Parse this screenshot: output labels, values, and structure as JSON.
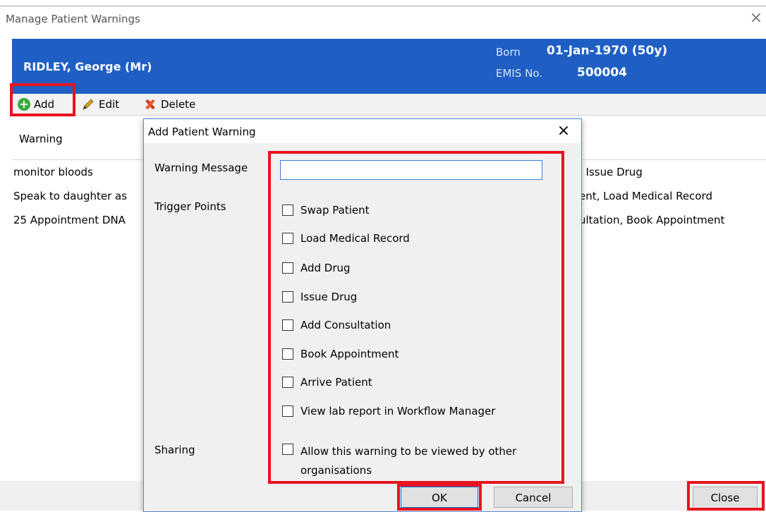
{
  "window": {
    "title": "Manage Patient Warnings",
    "close_glyph": "×"
  },
  "patient": {
    "name": "RIDLEY, George (Mr)",
    "born_label": "Born",
    "born_value": "01-Jan-1970 (50y)",
    "emis_label": "EMIS No.",
    "emis_value": "500004",
    "banner_color": "#1f5fc4"
  },
  "toolbar": {
    "add_label": "Add",
    "edit_label": "Edit",
    "delete_label": "Delete"
  },
  "grid": {
    "column_warning": "Warning",
    "rows": [
      {
        "warning": "monitor bloods",
        "triggers": ". Issue Drug"
      },
      {
        "warning": "Speak to daughter as",
        "triggers": "ent, Load Medical Record"
      },
      {
        "warning": "25 Appointment DNA",
        "triggers": "ultation, Book Appointment"
      }
    ]
  },
  "dialog": {
    "title": "Add Patient Warning",
    "close_glyph": "×",
    "message_label": "Warning Message",
    "message_value": "",
    "trigger_label": "Trigger Points",
    "triggers": [
      {
        "label": "Swap Patient",
        "checked": false
      },
      {
        "label": "Load Medical Record",
        "checked": false
      },
      {
        "label": "Add Drug",
        "checked": false
      },
      {
        "label": "Issue Drug",
        "checked": false
      },
      {
        "label": "Add Consultation",
        "checked": false
      },
      {
        "label": "Book Appointment",
        "checked": false
      },
      {
        "label": "Arrive Patient",
        "checked": false
      },
      {
        "label": "View lab report in Workflow Manager",
        "checked": false
      }
    ],
    "sharing_label": "Sharing",
    "sharing_option": "Allow this warning to be viewed by other organisations",
    "ok_label": "OK",
    "cancel_label": "Cancel"
  },
  "footer": {
    "close_label": "Close"
  },
  "colors": {
    "highlight": "#e8141f",
    "add_icon": "#3aa83a"
  }
}
